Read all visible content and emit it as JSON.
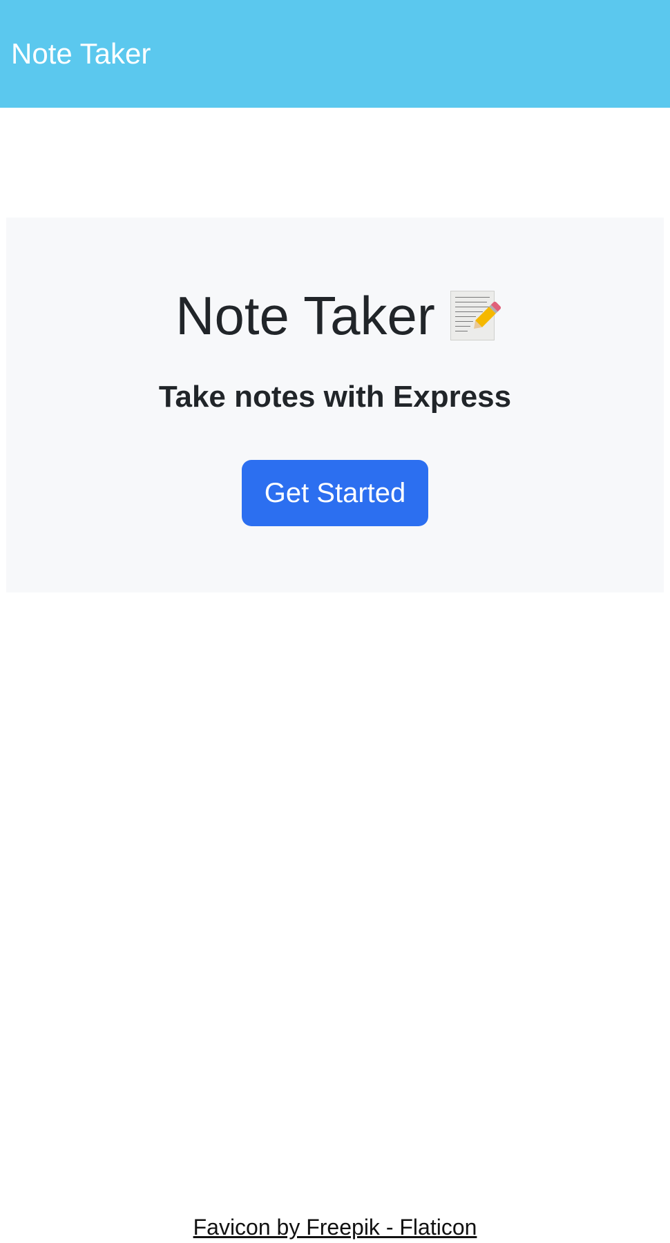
{
  "navbar": {
    "brand": "Note Taker"
  },
  "hero": {
    "title": "Note Taker",
    "title_icon": "memo-icon",
    "subtitle": "Take notes with Express",
    "cta_label": "Get Started"
  },
  "footer": {
    "link_text": "Favicon by Freepik - Flaticon"
  },
  "colors": {
    "navbar_bg": "#5bc8ee",
    "hero_bg": "#f7f8fa",
    "cta_bg": "#2c6ff0",
    "text_dark": "#212529"
  }
}
